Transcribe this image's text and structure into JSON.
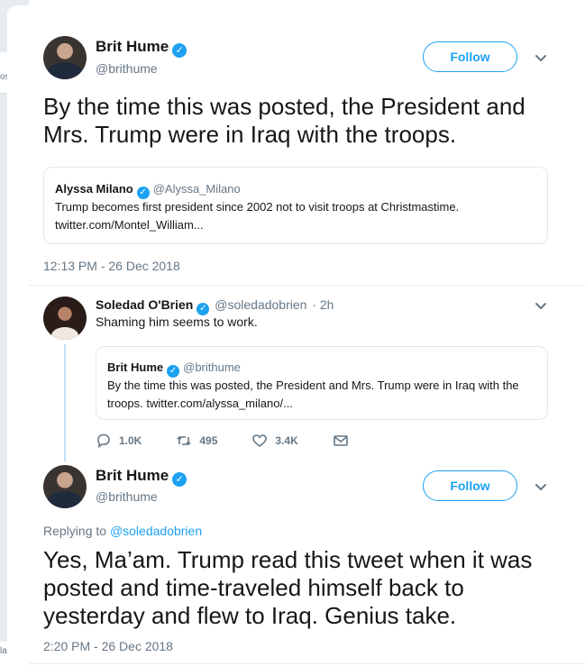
{
  "background": {
    "left_fragment_top": "os",
    "left_fragment_bottom": "la"
  },
  "tweet1": {
    "author_name": "Brit Hume",
    "author_handle": "@brithume",
    "follow_label": "Follow",
    "text": "By the time this was posted, the President and Mrs. Trump were in Iraq with the troops.",
    "quote": {
      "name": "Alyssa Milano",
      "handle": "@Alyssa_Milano",
      "text": "Trump becomes first president since 2002 not to visit troops at Christmastime. twitter.com/Montel_William..."
    },
    "timestamp": "12:13 PM - 26 Dec 2018"
  },
  "reply": {
    "author_name": "Soledad O'Brien",
    "author_handle": "@soledadobrien",
    "age": "· 2h",
    "text": "Shaming him seems to work.",
    "quote": {
      "name": "Brit Hume",
      "handle": "@brithume",
      "text": "By the time this was posted, the President and Mrs. Trump were in Iraq with the troops. twitter.com/alyssa_milano/..."
    },
    "actions": {
      "reply_count": "1.0K",
      "retweet_count": "495",
      "like_count": "3.4K"
    }
  },
  "tweet2": {
    "author_name": "Brit Hume",
    "author_handle": "@brithume",
    "follow_label": "Follow",
    "replying_prefix": "Replying to",
    "replying_to": "@soledadobrien",
    "text": "Yes, Ma’am. Trump read this tweet when it was posted and time-traveled himself back to yesterday and flew to Iraq. Genius take.",
    "timestamp": "2:20 PM - 26 Dec 2018"
  },
  "colors": {
    "accent": "#1da1f2",
    "text": "#14171a",
    "secondary": "#657786",
    "thread_line": "#c4dff6"
  },
  "icons": [
    "verified-icon",
    "chevron-down-icon",
    "reply-icon",
    "retweet-icon",
    "like-icon",
    "direct-message-icon"
  ]
}
